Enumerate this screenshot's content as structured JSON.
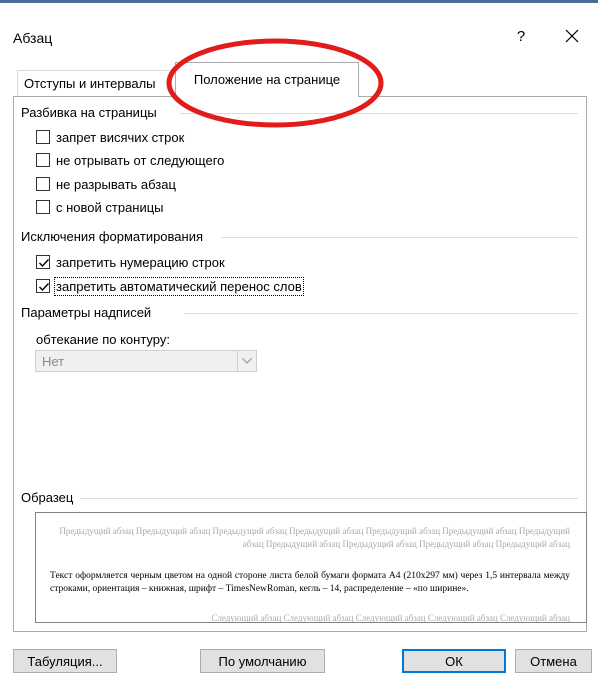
{
  "window": {
    "title": "Абзац",
    "help_label": "?"
  },
  "tabs": [
    {
      "label": "Отступы и интервалы",
      "active": false
    },
    {
      "label": "Положение на странице",
      "active": true
    }
  ],
  "highlight": {
    "color": "#e21b1b"
  },
  "pagination": {
    "title": "Разбивка на страницы",
    "options": [
      {
        "label": "запрет висячих строк",
        "checked": false
      },
      {
        "label": "не отрывать от следующего",
        "checked": false
      },
      {
        "label": "не разрывать абзац",
        "checked": false
      },
      {
        "label": "с новой страницы",
        "checked": false
      }
    ]
  },
  "formatting_exceptions": {
    "title": "Исключения форматирования",
    "options": [
      {
        "label": "запретить нумерацию строк",
        "checked": true
      },
      {
        "label": "запретить автоматический перенос слов",
        "checked": true
      }
    ]
  },
  "textbox_options": {
    "title": "Параметры надписей",
    "wrap_label": "обтекание по контуру:",
    "wrap_value": "Нет"
  },
  "preview": {
    "title": "Образец",
    "previous_text": "Предыдущий абзац Предыдущий абзац Предыдущий абзац Предыдущий абзац Предыдущий абзац Предыдущий абзац Предыдущий абзац Предыдущий абзац Предыдущий абзац Предыдущий абзац Предыдущий абзац",
    "main_text": "Текст оформляется черным цветом на одной стороне листа белой бумаги формата А4 (210х297 мм) через 1,5 интервала между строками, ориентация – книжная, шрифт – TimesNewRoman, кегль – 14, распределение – «по ширине».",
    "next_text": "Следующий абзац Следующий абзац Следующий абзац Следующий абзац Следующий абзац"
  },
  "buttons": {
    "tabs": "Табуляция...",
    "default": "По умолчанию",
    "ok": "ОК",
    "cancel": "Отмена"
  }
}
